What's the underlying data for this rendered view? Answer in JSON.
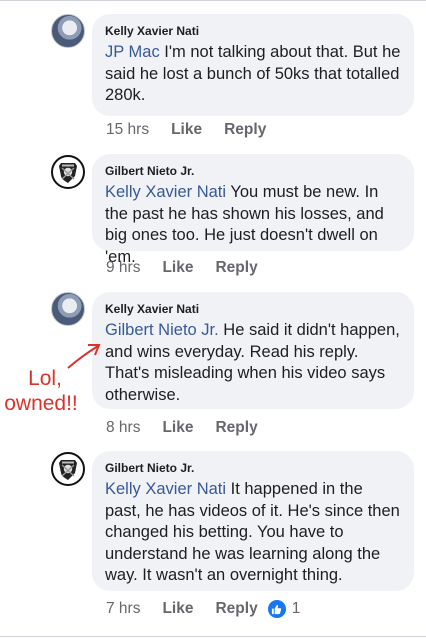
{
  "comments": [
    {
      "author": "Kelly Xavier Nati",
      "mention": "JP Mac",
      "body": " I'm not talking about that. But he said he lost a bunch of 50ks that totalled 280k.",
      "time": "15 hrs",
      "like_label": "Like",
      "reply_label": "Reply",
      "avatar_icon": "profile-photo-icon"
    },
    {
      "author": "Gilbert Nieto Jr.",
      "mention": "Kelly Xavier Nati",
      "body": " You must be new. In the past he has shown his losses, and big ones too. He just doesn't dwell on 'em.",
      "time": "9 hrs",
      "like_label": "Like",
      "reply_label": "Reply",
      "avatar_icon": "raiders-logo-icon"
    },
    {
      "author": "Kelly Xavier Nati",
      "mention": "Gilbert Nieto Jr.",
      "body": " He said it didn't happen, and wins everyday. Read his reply. That's misleading when his video says otherwise.",
      "time": "8 hrs",
      "like_label": "Like",
      "reply_label": "Reply",
      "avatar_icon": "profile-photo-icon"
    },
    {
      "author": "Gilbert Nieto Jr.",
      "mention": "Kelly Xavier Nati",
      "body": " It happened in the past, he has videos of it. He's since then changed his betting. You have to understand he was learning along the way. It wasn't an overnight thing.",
      "time": "7 hrs",
      "like_label": "Like",
      "reply_label": "Reply",
      "reaction_count": "1",
      "avatar_icon": "raiders-logo-icon"
    }
  ],
  "annotation": {
    "line1": "Lol,",
    "line2": "owned!!",
    "color": "#d9342b"
  },
  "colors": {
    "mention": "#385898",
    "bubble": "#f0f2f5",
    "meta": "#65676b",
    "like_reaction": "#1877f2"
  }
}
